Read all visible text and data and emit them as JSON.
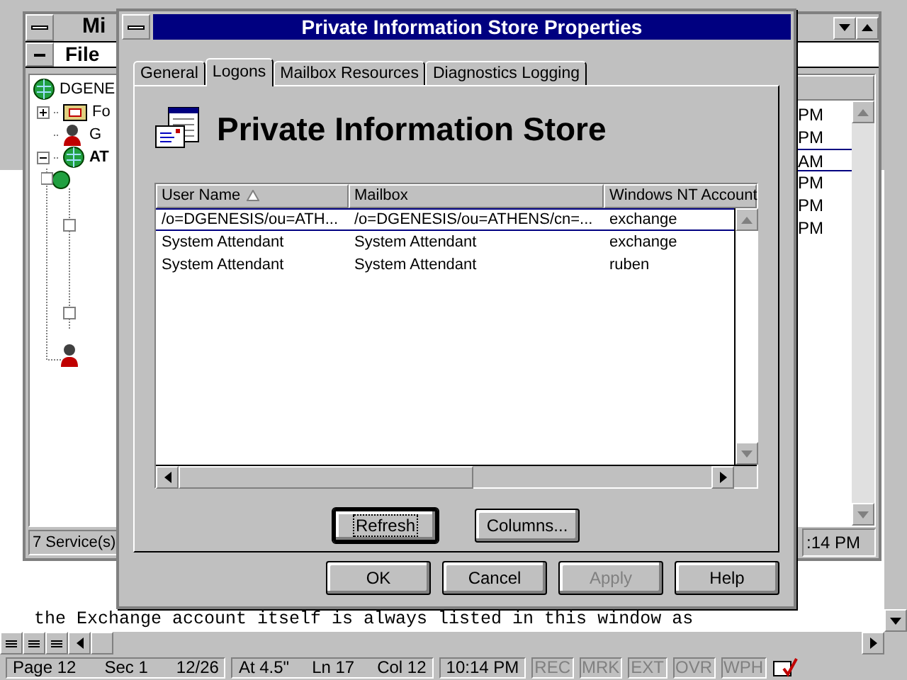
{
  "word": {
    "document_line": "the Exchange account itself is always listed in this window as",
    "status_fields": [
      "Page 12",
      "Sec 1",
      "12/26",
      "At 4.5\"",
      "Ln 17",
      "Col 12",
      "10:14 PM"
    ],
    "indicators": [
      {
        "label": "REC",
        "on": false
      },
      {
        "label": "MRK",
        "on": false
      },
      {
        "label": "EXT",
        "on": false
      },
      {
        "label": "OVR",
        "on": false
      },
      {
        "label": "WPH",
        "on": false
      }
    ]
  },
  "admin_window": {
    "title": "Mi",
    "menu": [
      "File"
    ],
    "tree": [
      {
        "label": "DGENE",
        "kind": "org",
        "children": [
          {
            "label": "Fo",
            "kind": "folder",
            "expanded": false
          },
          {
            "label": "G",
            "kind": "person"
          },
          {
            "label": "AT",
            "kind": "site",
            "expanded": true
          }
        ]
      }
    ],
    "times": [
      {
        "text": "PM",
        "selected": false
      },
      {
        "text": "PM",
        "selected": false
      },
      {
        "text": "AM",
        "selected": true
      },
      {
        "text": "PM",
        "selected": false
      },
      {
        "text": "PM",
        "selected": false
      },
      {
        "text": "PM",
        "selected": false
      }
    ],
    "status": "7 Service(s)",
    "status_time": ":14 PM"
  },
  "dialog": {
    "title": "Private Information Store Properties",
    "tabs": [
      {
        "label": "General",
        "selected": false
      },
      {
        "label": "Logons",
        "selected": true
      },
      {
        "label": "Mailbox Resources",
        "selected": false
      },
      {
        "label": "Diagnostics Logging",
        "selected": false
      }
    ],
    "heading": "Private Information Store",
    "columns": [
      {
        "label": "User Name",
        "sorted": true
      },
      {
        "label": "Mailbox",
        "sorted": false
      },
      {
        "label": "Windows NT Account",
        "sorted": false
      }
    ],
    "rows": [
      {
        "cells": [
          "/o=DGENESIS/ou=ATH...",
          "/o=DGENESIS/ou=ATHENS/cn=...",
          "exchange"
        ],
        "selected": true
      },
      {
        "cells": [
          "System Attendant",
          "System Attendant",
          "exchange"
        ],
        "selected": false
      },
      {
        "cells": [
          "System Attendant",
          "System Attendant",
          "ruben"
        ],
        "selected": false
      }
    ],
    "panel_buttons": [
      {
        "label": "Refresh",
        "focused": true
      },
      {
        "label": "Columns...",
        "focused": false
      }
    ],
    "buttons": [
      {
        "label": "OK",
        "disabled": false
      },
      {
        "label": "Cancel",
        "disabled": false
      },
      {
        "label": "Apply",
        "disabled": true
      },
      {
        "label": "Help",
        "disabled": false
      }
    ]
  }
}
